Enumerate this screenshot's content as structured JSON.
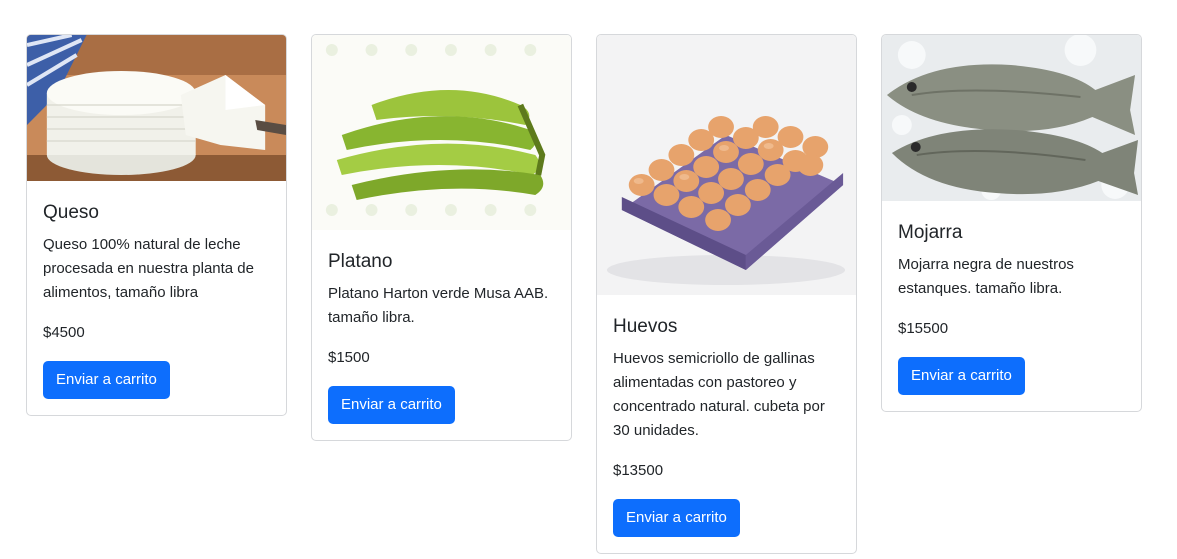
{
  "products": [
    {
      "name": "Queso",
      "description": "Queso 100% natural de leche procesada en nuestra planta de alimentos, tamaño libra",
      "price": "$4500",
      "button_label": "Enviar a carrito",
      "image_icon": "cheese-image"
    },
    {
      "name": "Platano",
      "description": "Platano Harton verde Musa AAB. tamaño libra.",
      "price": "$1500",
      "button_label": "Enviar a carrito",
      "image_icon": "plantain-image"
    },
    {
      "name": "Huevos",
      "description": "Huevos semicriollo de gallinas alimentadas con pastoreo y concentrado natural. cubeta por 30 unidades.",
      "price": "$13500",
      "button_label": "Enviar a carrito",
      "image_icon": "eggs-image"
    },
    {
      "name": "Mojarra",
      "description": "Mojarra negra de nuestros estanques. tamaño libra.",
      "price": "$15500",
      "button_label": "Enviar a carrito",
      "image_icon": "fish-image"
    }
  ],
  "colors": {
    "primary": "#0d6efd",
    "text": "#212529",
    "border": "#d6d8db"
  }
}
